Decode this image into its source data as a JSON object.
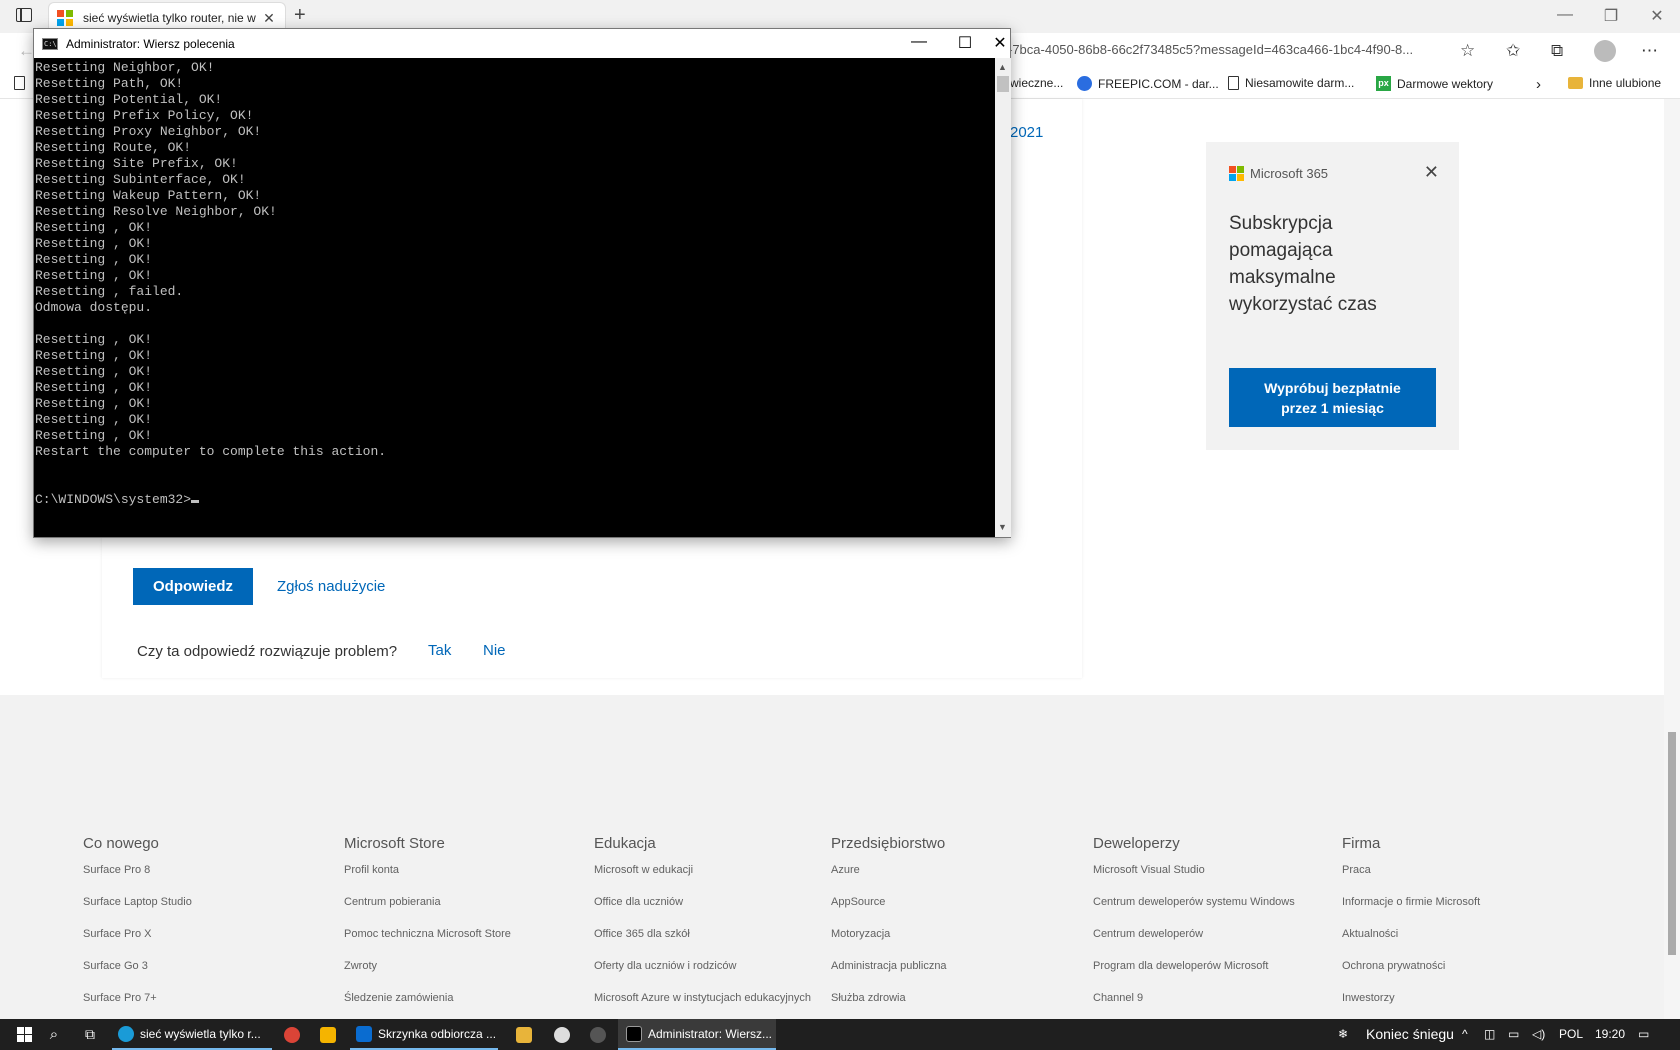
{
  "browser": {
    "tab_title": "sieć wyświetla tylko router, nie w",
    "url": "-7bca-4050-86b8-66c2f73485c5?messageId=463ca466-1bc4-4f90-8...",
    "favorites": [
      {
        "label": "wieczne..."
      },
      {
        "label": "FREEPIC.COM - dar..."
      },
      {
        "label": "Niesamowite darm..."
      },
      {
        "label": "Darmowe wektory"
      },
      {
        "label": "Inne ulubione"
      }
    ]
  },
  "page": {
    "year_link": "2021",
    "reply_button": "Odpowiedz",
    "report_link": "Zgłoś nadużycie",
    "question": "Czy ta odpowiedź rozwiązuje problem?",
    "yes": "Tak",
    "no": "Nie"
  },
  "promo": {
    "brand": "Microsoft 365",
    "text": "Subskrypcja pomagająca maksymalne wykorzystać czas",
    "button": "Wypróbuj bezpłatnie przez 1 miesiąc"
  },
  "footer": {
    "columns": [
      {
        "heading": "Co nowego",
        "items": [
          "Surface Pro 8",
          "Surface Laptop Studio",
          "Surface Pro X",
          "Surface Go 3",
          "Surface Pro 7+"
        ]
      },
      {
        "heading": "Microsoft Store",
        "items": [
          "Profil konta",
          "Centrum pobierania",
          "Pomoc techniczna Microsoft Store",
          "Zwroty",
          "Śledzenie zamówienia"
        ]
      },
      {
        "heading": "Edukacja",
        "items": [
          "Microsoft w edukacji",
          "Office dla uczniów",
          "Office 365 dla szkół",
          "Oferty dla uczniów i rodziców",
          "Microsoft Azure w instytucjach edukacyjnych"
        ]
      },
      {
        "heading": "Przedsiębiorstwo",
        "items": [
          "Azure",
          "AppSource",
          "Motoryzacja",
          "Administracja publiczna",
          "Służba zdrowia"
        ]
      },
      {
        "heading": "Deweloperzy",
        "items": [
          "Microsoft Visual Studio",
          "Centrum deweloperów systemu Windows",
          "Centrum deweloperów",
          "Program dla deweloperów Microsoft",
          "Channel 9"
        ]
      },
      {
        "heading": "Firma",
        "items": [
          "Praca",
          "Informacje o firmie Microsoft",
          "Aktualności",
          "Ochrona prywatności",
          "Inwestorzy"
        ]
      }
    ]
  },
  "cmd": {
    "title": "Administrator: Wiersz polecenia",
    "icon_text": "C:\\",
    "lines": [
      "Resetting Neighbor, OK!",
      "Resetting Path, OK!",
      "Resetting Potential, OK!",
      "Resetting Prefix Policy, OK!",
      "Resetting Proxy Neighbor, OK!",
      "Resetting Route, OK!",
      "Resetting Site Prefix, OK!",
      "Resetting Subinterface, OK!",
      "Resetting Wakeup Pattern, OK!",
      "Resetting Resolve Neighbor, OK!",
      "Resetting , OK!",
      "Resetting , OK!",
      "Resetting , OK!",
      "Resetting , OK!",
      "Resetting , failed.",
      "Odmowa dostępu.",
      "",
      "Resetting , OK!",
      "Resetting , OK!",
      "Resetting , OK!",
      "Resetting , OK!",
      "Resetting , OK!",
      "Resetting , OK!",
      "Resetting , OK!",
      "Restart the computer to complete this action.",
      "",
      ""
    ],
    "prompt": "C:\\WINDOWS\\system32>"
  },
  "taskbar": {
    "edge_label": "sieć wyświetla tylko r...",
    "mail_label": "Skrzynka odbiorcza ...",
    "cmd_label": "Administrator: Wiersz...",
    "weather": "Koniec śniegu",
    "language": "POL",
    "time": "19:20"
  },
  "colors": {
    "accent": "#0067b8",
    "cmd_bg": "#000000",
    "cmd_text": "#c0c0c0",
    "taskbar": "#1f1f1f"
  }
}
